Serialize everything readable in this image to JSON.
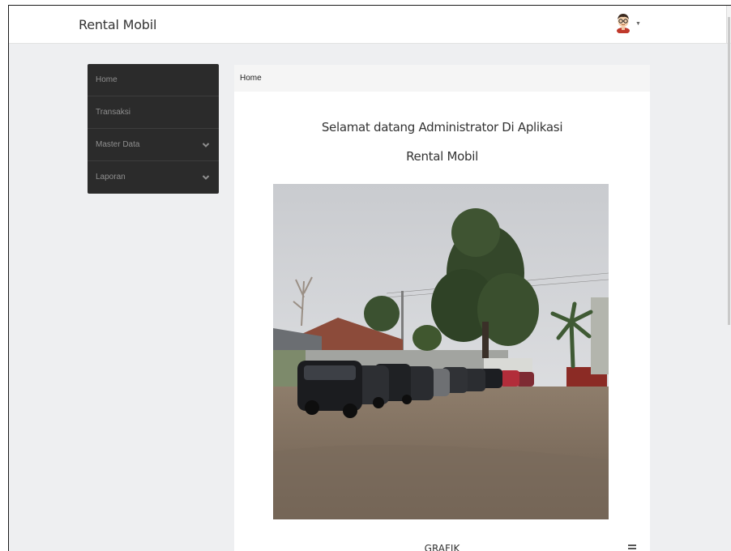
{
  "app": {
    "brand": "Rental Mobil"
  },
  "header": {
    "user_avatar_icon": "user-avatar-icon",
    "caret_icon": "caret-down-icon"
  },
  "sidebar": {
    "items": [
      {
        "label": "Home",
        "has_chevron": false
      },
      {
        "label": "Transaksi",
        "has_chevron": false
      },
      {
        "label": "Master Data",
        "has_chevron": true
      },
      {
        "label": "Laporan",
        "has_chevron": true
      }
    ]
  },
  "main": {
    "breadcrumb": "Home",
    "welcome_line1": "Selamat datang Administrator Di Aplikasi",
    "welcome_line2": "Rental Mobil",
    "photo_icon": "car-lot-photo",
    "chart_section_title": "GRAFIK",
    "chart_menu_icon": "hamburger-menu-icon"
  },
  "colors": {
    "sidebar_bg": "#2b2b2b",
    "sidebar_text": "#8f8f8f",
    "page_bg": "#eeeff1",
    "panel_bg": "#ffffff",
    "breadcrumb_bg": "#f5f5f5"
  }
}
